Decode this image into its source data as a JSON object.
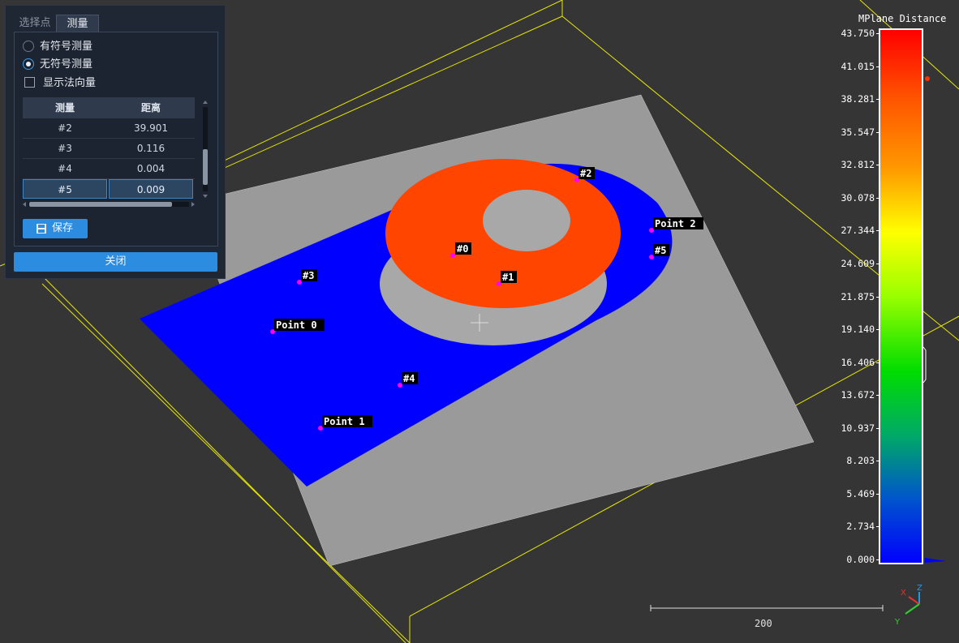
{
  "panel": {
    "tabs": [
      "选择点",
      "测量"
    ],
    "active_tab": 1,
    "radio_signed": "有符号测量",
    "radio_unsigned": "无符号测量",
    "selected_radio": "无符号测量",
    "show_normal_label": "显示法向量",
    "show_normal_checked": false,
    "table": {
      "headers": [
        "测量",
        "距离"
      ],
      "rows": [
        {
          "id": "#2",
          "distance": "39.901"
        },
        {
          "id": "#3",
          "distance": "0.116"
        },
        {
          "id": "#4",
          "distance": "0.004"
        },
        {
          "id": "#5",
          "distance": "0.009"
        }
      ],
      "selected_row": 3
    },
    "save_label": "保存",
    "close_label": "关闭"
  },
  "viewport": {
    "point_labels": [
      "#0",
      "#1",
      "#2",
      "#3",
      "#4",
      "#5",
      "Point 0",
      "Point 1",
      "Point 2"
    ],
    "scale_bar_label": "200",
    "axes": {
      "x": "X",
      "y": "Y",
      "z": "Z"
    }
  },
  "colorbar": {
    "title": "MPlane Distance",
    "ticks": [
      "43.750",
      "41.015",
      "38.281",
      "35.547",
      "32.812",
      "30.078",
      "27.344",
      "24.609",
      "21.875",
      "19.140",
      "16.406",
      "13.672",
      "10.937",
      "8.203",
      "5.469",
      "2.734",
      "0.000"
    ],
    "min": 0.0,
    "max": 43.75
  },
  "colors": {
    "background": "#353535",
    "box_lines": "#e8e800",
    "plane_blue": "#0000ff",
    "plane_gray": "#9a9a9a",
    "top_face": "#ff4500",
    "marker": "#ff00ff",
    "accent": "#2c8de0"
  }
}
